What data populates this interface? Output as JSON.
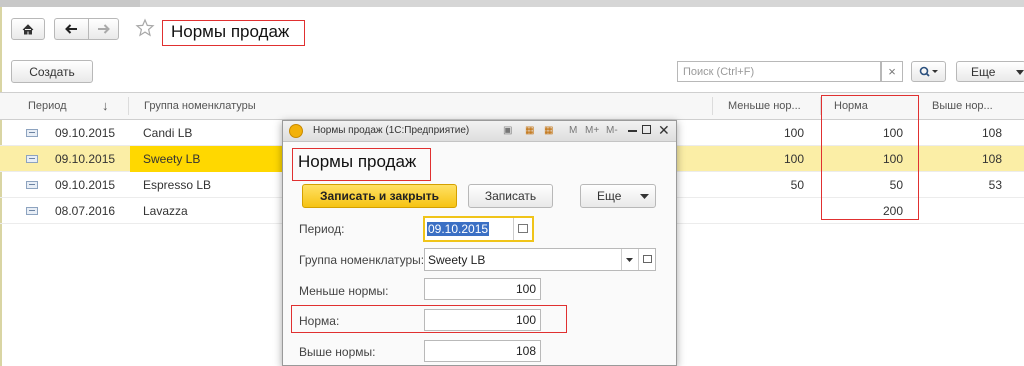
{
  "header": {
    "title": "Нормы продаж",
    "home_icon": "home-icon",
    "back_icon": "arrow-left-icon",
    "forward_icon": "arrow-right-icon",
    "favorite_icon": "star-icon"
  },
  "toolbar": {
    "create_label": "Создать",
    "search_placeholder": "Поиск (Ctrl+F)",
    "clear_icon": "×",
    "search_menu_icon": "search-icon",
    "more_label": "Еще"
  },
  "table": {
    "columns": [
      "Период",
      "Группа номенклатуры",
      "Меньше нор...",
      "Норма",
      "Выше нор..."
    ],
    "sort_indicator": "↓",
    "rows": [
      {
        "period": "09.10.2015",
        "group": "Candi LB",
        "less": "100",
        "norm": "100",
        "more": "108"
      },
      {
        "period": "09.10.2015",
        "group": "Sweety LB",
        "less": "100",
        "norm": "100",
        "more": "108"
      },
      {
        "period": "09.10.2015",
        "group": "Espresso LB",
        "less": "50",
        "norm": "50",
        "more": "53"
      },
      {
        "period": "08.07.2016",
        "group": "Lavazza",
        "less": "",
        "norm": "200",
        "more": ""
      }
    ],
    "selected_row": 1
  },
  "dialog": {
    "window_title": "Нормы продаж  (1С:Предприятие)",
    "toolbar_labels": [
      "M",
      "M+",
      "M-"
    ],
    "heading": "Нормы продаж",
    "save_close_label": "Записать и закрыть",
    "save_label": "Записать",
    "more_label": "Еще",
    "fields": {
      "period_label": "Период:",
      "period_value": "09.10.2015",
      "group_label": "Группа номенклатуры:",
      "group_value": "Sweety LB",
      "less_label": "Меньше нормы:",
      "less_value": "100",
      "norm_label": "Норма:",
      "norm_value": "100",
      "more_label": "Выше нормы:",
      "more_value": "108"
    }
  },
  "colors": {
    "selected_row": "#fbeea6",
    "selected_cell": "#ffd800",
    "primary_button": "#ffd22a",
    "highlight_box": "#e03030",
    "period_focus": "#f0c419"
  }
}
